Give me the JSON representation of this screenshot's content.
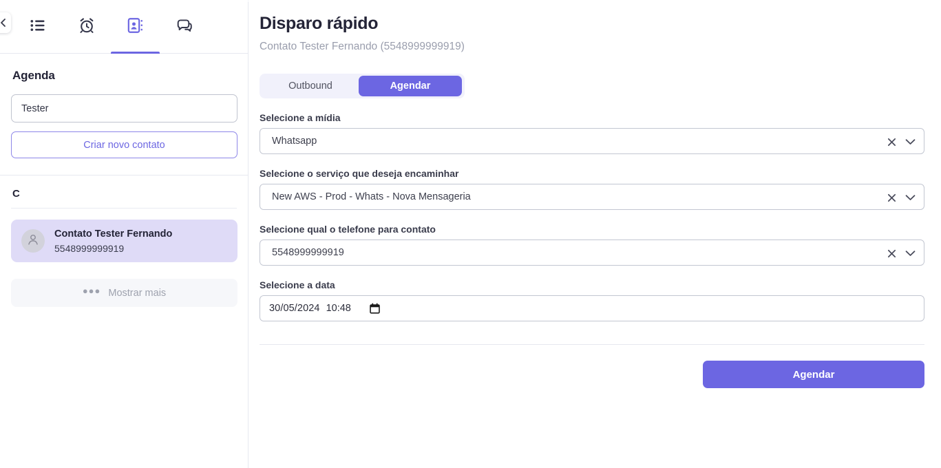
{
  "tabs": [
    {
      "name": "tab-list",
      "icon": "list-icon",
      "active": false
    },
    {
      "name": "tab-schedule",
      "icon": "alarm-clock-icon",
      "active": false
    },
    {
      "name": "tab-contacts",
      "icon": "contact-book-icon",
      "active": true
    },
    {
      "name": "tab-chats",
      "icon": "chat-bubbles-icon",
      "active": false
    }
  ],
  "sidebar": {
    "collapse_icon": "chevron-left-icon",
    "title": "Agenda",
    "search": {
      "value": "Tester",
      "placeholder": ""
    },
    "new_contact_label": "Criar novo contato",
    "group_letter": "C",
    "contacts": [
      {
        "name": "Contato Tester Fernando",
        "phone": "5548999999919",
        "avatar_icon": "user-avatar-icon",
        "selected": true
      }
    ],
    "show_more_label": "Mostrar mais",
    "show_more_icon": "ellipsis-icon"
  },
  "main": {
    "title": "Disparo rápido",
    "subtitle": "Contato Tester Fernando (5548999999919)",
    "segmented": [
      {
        "label": "Outbound",
        "active": false
      },
      {
        "label": "Agendar",
        "active": true
      }
    ],
    "fields": [
      {
        "label": "Selecione a mídia",
        "value": "Whatsapp",
        "clear_icon": "close-icon",
        "chevron_icon": "chevron-down-icon"
      },
      {
        "label": "Selecione o serviço que deseja encaminhar",
        "value": "New AWS - Prod - Whats - Nova Mensageria",
        "clear_icon": "close-icon",
        "chevron_icon": "chevron-down-icon"
      },
      {
        "label": "Selecione qual o telefone para contato",
        "value": "5548999999919",
        "clear_icon": "close-icon",
        "chevron_icon": "chevron-down-icon"
      }
    ],
    "date_field": {
      "label": "Selecione a data",
      "date": "30/05/2024",
      "time": "10:48",
      "calendar_icon": "calendar-icon"
    },
    "submit_label": "Agendar"
  },
  "colors": {
    "accent": "#6C66E2",
    "accent_soft": "#DFDBF7",
    "segment_track": "#F1F1FB",
    "border": "#C2C6D1",
    "muted_text": "#9A9EAD"
  }
}
